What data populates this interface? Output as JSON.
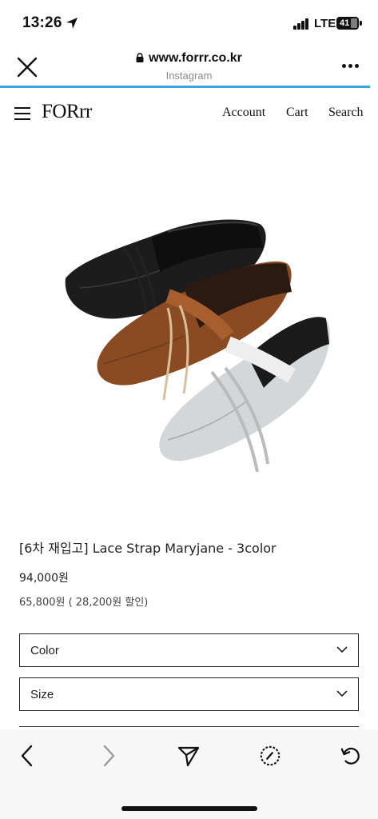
{
  "status_bar": {
    "time": "13:26",
    "network": "LTE",
    "battery": "41"
  },
  "browser": {
    "url": "www.forrr.co.kr",
    "source": "Instagram"
  },
  "site": {
    "logo": "FORrr",
    "nav": {
      "account": "Account",
      "cart": "Cart",
      "search": "Search"
    }
  },
  "product": {
    "title": "[6차 재입고] Lace Strap Maryjane - 3color",
    "price": "94,000원",
    "sale_line": "65,800원 ( 28,200원 할인)",
    "options": [
      {
        "label": "Color"
      },
      {
        "label": "Size"
      }
    ],
    "shoe_colors": [
      "#1c1c1c",
      "#8a4a22",
      "#c9cbcd"
    ]
  },
  "toolbar": {
    "icons": [
      "back-icon",
      "forward-icon",
      "share-icon",
      "compass-icon",
      "reload-icon"
    ]
  }
}
